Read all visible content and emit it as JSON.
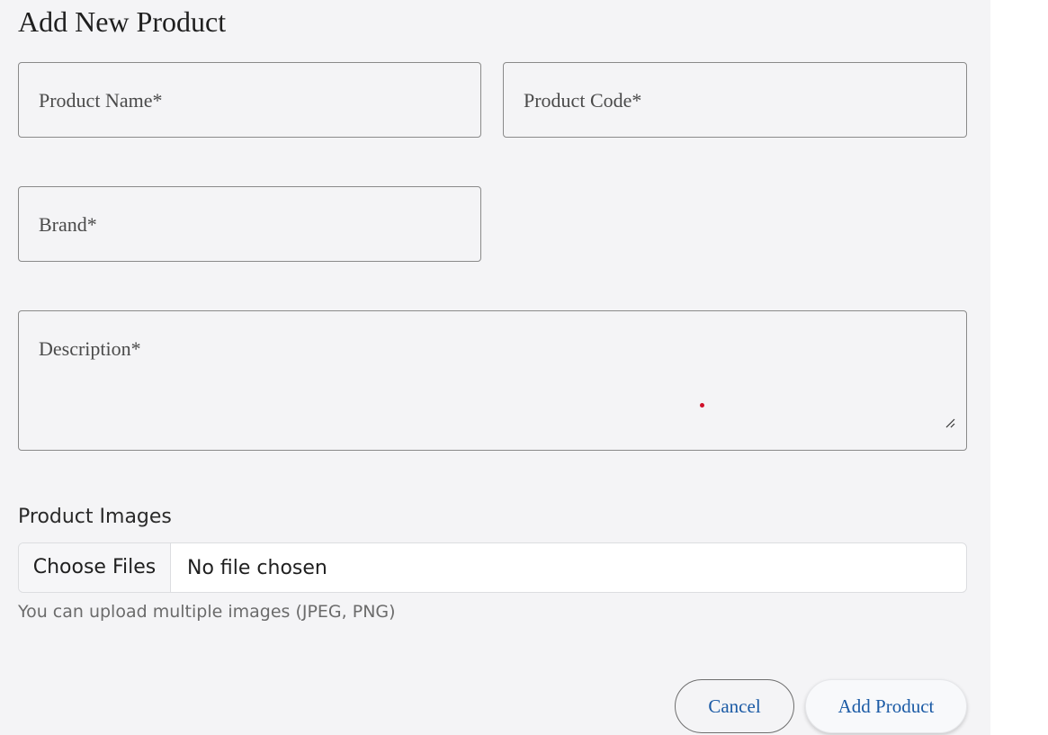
{
  "form": {
    "title": "Add New Product",
    "fields": {
      "product_name": {
        "placeholder": "Product Name*"
      },
      "product_code": {
        "placeholder": "Product Code*"
      },
      "brand": {
        "placeholder": "Brand*"
      },
      "description": {
        "placeholder": "Description*"
      }
    },
    "images": {
      "label": "Product Images",
      "choose_button": "Choose Files",
      "status": "No file chosen",
      "help": "You can upload multiple images (JPEG, PNG)"
    },
    "actions": {
      "cancel": "Cancel",
      "submit": "Add Product"
    }
  },
  "colors": {
    "panel_background": "#f4f4f6",
    "button_text": "#1a5aa5",
    "field_border": "#8a8a8a",
    "cursor_dot": "#d0102a"
  }
}
